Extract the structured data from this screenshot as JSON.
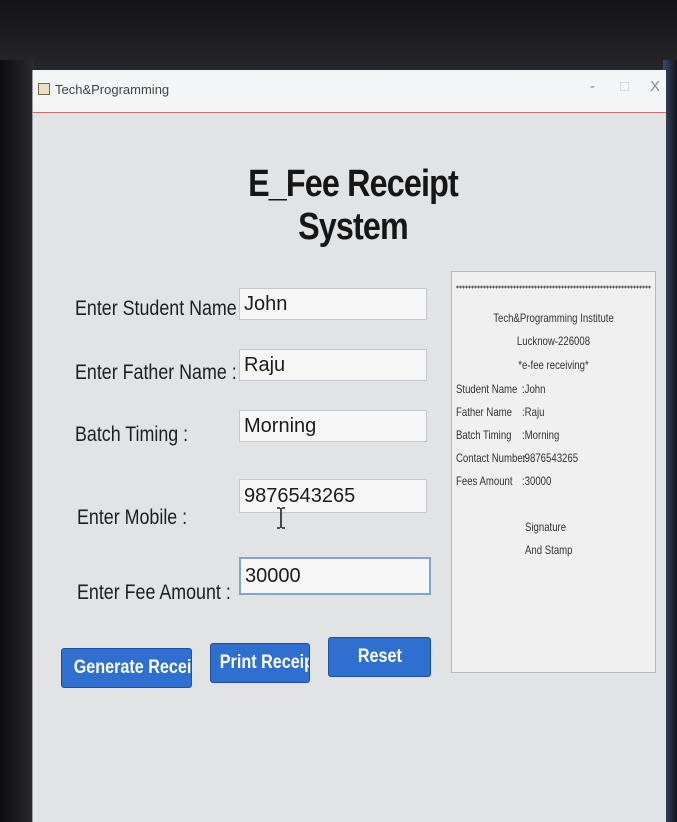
{
  "window": {
    "title": "Tech&Programming",
    "minimize": "-",
    "maximize": "□",
    "close": "X"
  },
  "heading": "E_Fee Receipt System",
  "form": {
    "student_name_label": "Enter Student Name :",
    "student_name_value": "John",
    "father_name_label": "Enter Father Name :",
    "father_name_value": "Raju",
    "batch_label": "Batch Timing :",
    "batch_value": "Morning",
    "mobile_label": "Enter Mobile :",
    "mobile_value": "9876543265",
    "fee_label": "Enter Fee Amount :",
    "fee_value": "30000"
  },
  "buttons": {
    "generate": "Generate Receipt",
    "print": "Print Receipt",
    "reset": "Reset"
  },
  "receipt": {
    "institute": "Tech&Programming Institute",
    "address": "Lucknow-226008",
    "subtitle": "*e-fee receiving*",
    "rows": [
      {
        "key": "Student Name",
        "value": ":John"
      },
      {
        "key": "Father Name",
        "value": ":Raju"
      },
      {
        "key": "Batch Timing",
        "value": ":Morning"
      },
      {
        "key": "Contact Number",
        "value": ":9876543265"
      },
      {
        "key": "Fees Amount",
        "value": ":30000"
      }
    ],
    "signature": "Signature",
    "stamp": "And Stamp"
  },
  "colors": {
    "button_blue": "#2f6fd0",
    "title_bar_border": "#d56b6b",
    "focus_border": "#7fa6d2"
  },
  "icons": {
    "app_icon": "java-cup-icon",
    "text_cursor": "ibeam-cursor-icon"
  }
}
